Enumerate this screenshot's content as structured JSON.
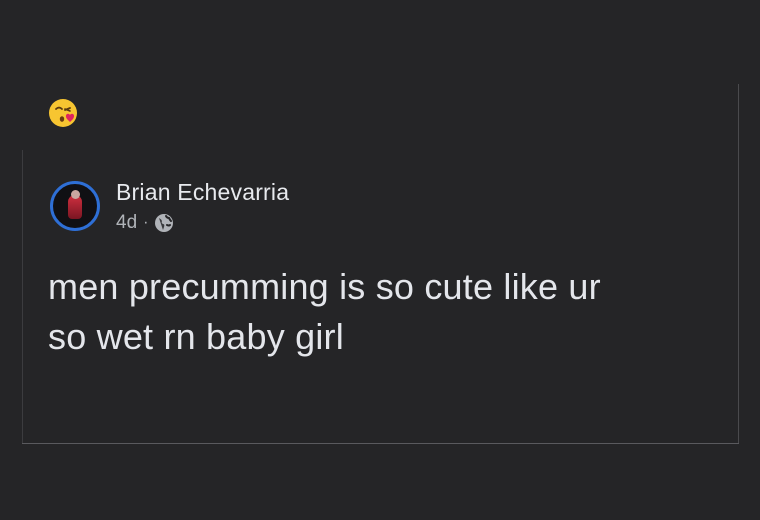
{
  "reaction": {
    "icon": "kissing-face-with-heart-icon"
  },
  "post": {
    "author": "Brian Echevarria",
    "time": "4d",
    "separator": "·",
    "privacy_icon": "globe-icon",
    "text_lines": [
      "men precumming is so cute like ur",
      "so wet rn baby girl"
    ]
  },
  "colors": {
    "background": "#252527",
    "text": "#e4e6eb",
    "muted": "#b0b3b8",
    "avatar_ring": "#2e6fd6"
  }
}
